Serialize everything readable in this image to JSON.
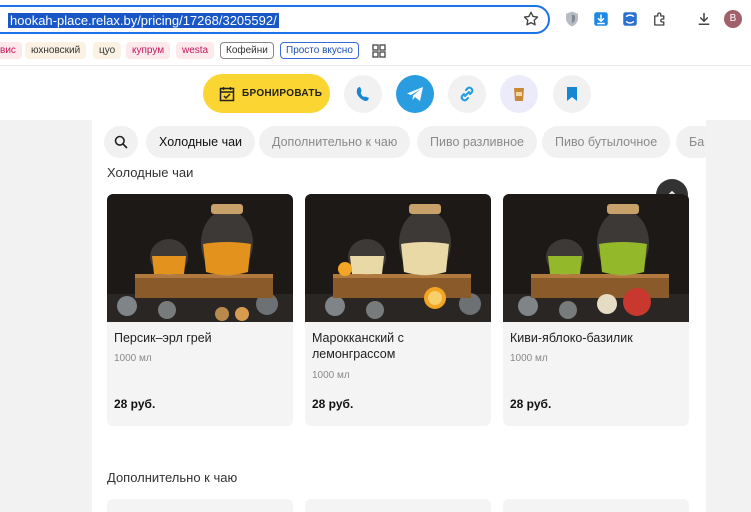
{
  "browser": {
    "url": "hookah-place.relax.by/pricing/17268/3205592/",
    "avatar_letter": "B",
    "bookmarks": [
      "вис",
      "юхновский",
      "цуо",
      "купрум",
      "westa",
      "Кофейни",
      "Просто вкусно"
    ]
  },
  "actions": {
    "book_label": "БРОНИРОВАТЬ",
    "accent_color": "#fbd531",
    "icons": [
      "phone-icon",
      "telegram-icon",
      "link-icon",
      "coffee-icon",
      "bookmark-icon"
    ]
  },
  "tabs": [
    "Холодные чаи",
    "Дополнительно к чаю",
    "Пиво разливное",
    "Пиво бутылочное",
    "Ба"
  ],
  "sections": [
    {
      "title": "Холодные чаи",
      "items": [
        {
          "name": "Персик–эрл грей",
          "volume": "1000 мл",
          "price": "28 руб.",
          "drink_color": "#e3921d"
        },
        {
          "name": "Марокканский с лемонграссом",
          "volume": "1000 мл",
          "price": "28 руб.",
          "drink_color": "#e9d9a6"
        },
        {
          "name": "Киви-яблоко-базилик",
          "volume": "1000 мл",
          "price": "28 руб.",
          "drink_color": "#93b82a"
        }
      ]
    },
    {
      "title": "Дополнительно к чаю"
    }
  ]
}
